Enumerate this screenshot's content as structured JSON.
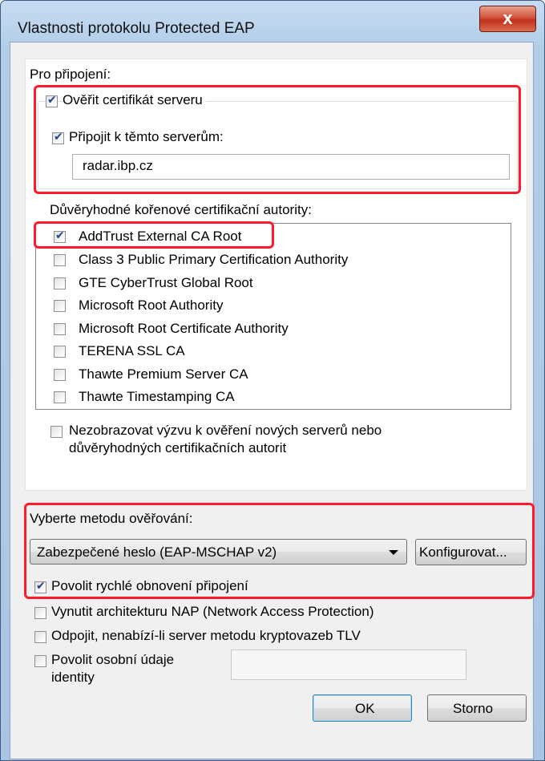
{
  "window": {
    "title": "Vlastnosti protokolu Protected EAP",
    "close_glyph": "x"
  },
  "connection": {
    "group_label": "Pro připojení:",
    "verify_cert": {
      "label": "Ověřit certifikát serveru",
      "checked": true
    },
    "connect_servers": {
      "label": "Připojit k těmto serverům:",
      "checked": true
    },
    "servers_value": "radar.ibp.cz",
    "trusted_label": "Důvěryhodné kořenové certifikační autority:",
    "authorities": [
      {
        "label": "AddTrust External CA Root",
        "checked": true
      },
      {
        "label": "Class 3 Public Primary Certification Authority",
        "checked": false
      },
      {
        "label": "GTE CyberTrust Global Root",
        "checked": false
      },
      {
        "label": "Microsoft Root Authority",
        "checked": false
      },
      {
        "label": "Microsoft Root Certificate Authority",
        "checked": false
      },
      {
        "label": "TERENA SSL CA",
        "checked": false
      },
      {
        "label": "Thawte Premium Server CA",
        "checked": false
      },
      {
        "label": "Thawte Timestamping CA",
        "checked": false
      }
    ],
    "no_prompt": {
      "line1": "Nezobrazovat výzvu k ověření nových serverů nebo",
      "line2": "důvěryhodných certifikačních autorit",
      "checked": false
    }
  },
  "auth": {
    "method_label": "Vyberte metodu ověřování:",
    "method_selected": "Zabezpečené heslo (EAP-MSCHAP v2)",
    "configure_label": "Konfigurovat...",
    "fast_reconnect": {
      "label": "Povolit rychlé obnovení připojení",
      "checked": true
    },
    "nap": {
      "label": "Vynutit architekturu NAP (Network Access Protection)",
      "checked": false
    },
    "disconnect_tlv": {
      "label": "Odpojit, nenabízí-li server metodu kryptovazeb TLV",
      "checked": false
    },
    "identity_privacy": {
      "line1": "Povolit osobní údaje",
      "line2": "identity",
      "checked": false,
      "value": ""
    }
  },
  "buttons": {
    "ok": "OK",
    "cancel": "Storno"
  },
  "colors": {
    "highlight_red": "#ff1c2a",
    "check_blue": "#24458c",
    "title_blue": "#b3cde8"
  }
}
